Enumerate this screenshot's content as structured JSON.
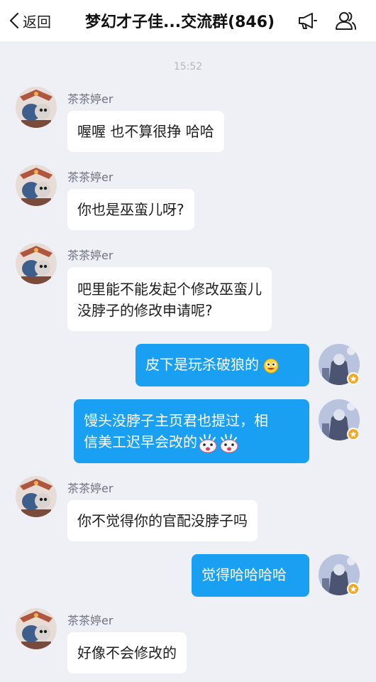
{
  "header": {
    "back_label": "返回",
    "title": "梦幻才子佳...交流群(846)"
  },
  "timestamp": "15:52",
  "messages": [
    {
      "sender": "茶茶婷er",
      "text": "喔喔 也不算很挣 哈哈"
    },
    {
      "sender": "茶茶婷er",
      "text": "你也是巫蛮儿呀?"
    },
    {
      "sender": "茶茶婷er",
      "text": "吧里能不能发起个修改巫蛮儿\n没脖子的修改申请呢?"
    },
    {
      "text": "皮下是玩杀破狼的",
      "emoji": "silly-face"
    },
    {
      "text": "馒头没脖子主页君也提过，相\n信美工迟早会改的",
      "emoji": "surprised-face x2"
    },
    {
      "sender": "茶茶婷er",
      "text": "你不觉得你的官配没脖子吗"
    },
    {
      "text": "觉得哈哈哈哈"
    },
    {
      "sender": "茶茶婷er",
      "text": "好像不会修改的"
    }
  ],
  "colors": {
    "outgoing_bubble": "#1aa0f3",
    "incoming_bubble": "#ffffff",
    "background": "#eef0f5",
    "badge": "#f5a623"
  }
}
